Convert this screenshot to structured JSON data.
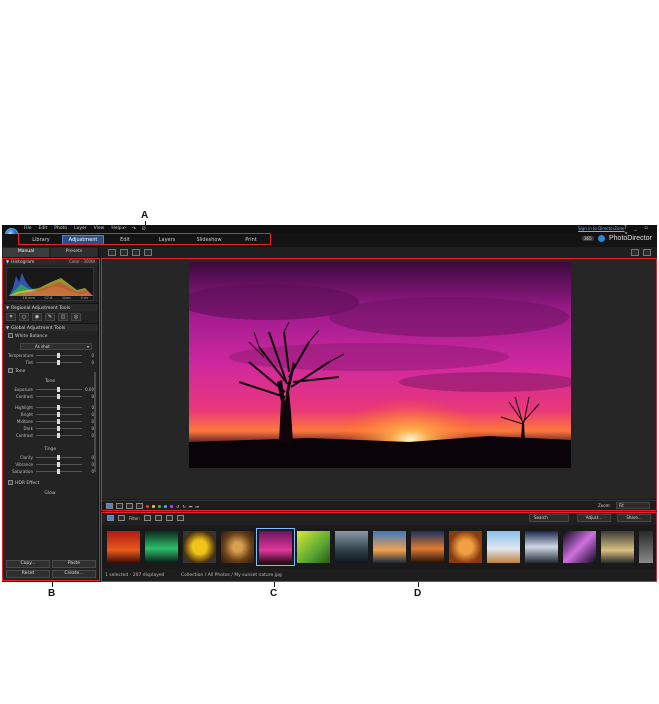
{
  "callouts": {
    "a": "A",
    "b": "B",
    "c": "C",
    "d": "D"
  },
  "menu": [
    "File",
    "Edit",
    "Photo",
    "Layer",
    "View",
    "Help"
  ],
  "undo_redo": "↶ ↷ ⊙",
  "signin": "Sign in to DirectorZone",
  "window_controls": "? _ ▫ ×",
  "modes": [
    "Library",
    "Adjustment",
    "Edit",
    "Layers",
    "Slideshow",
    "Print"
  ],
  "active_mode": "Adjustment",
  "brand": {
    "badge": "365",
    "name": "PhotoDirector"
  },
  "left": {
    "tabs": [
      "Manual",
      "Presets"
    ],
    "histogram": {
      "title": "Histogram",
      "mode": "Color · 300W",
      "info": [
        "-",
        "16 mm",
        "f/2.8",
        "1/sec",
        "0 ev"
      ]
    },
    "regional": "Regional Adjustment Tools",
    "global": "Global Adjustment Tools",
    "white_balance": {
      "title": "White Balance",
      "preset": "As shot",
      "sliders": [
        {
          "label": "Temperature",
          "value": "0"
        },
        {
          "label": "Tint",
          "value": "0"
        }
      ]
    },
    "tone": {
      "title": "Tone",
      "group": "Tone",
      "sliders": [
        {
          "label": "Exposure",
          "value": "0.00"
        },
        {
          "label": "Contrast",
          "value": "0"
        },
        {
          "label": "Highlight",
          "value": "0"
        },
        {
          "label": "Bright",
          "value": "0"
        },
        {
          "label": "Midtone",
          "value": "0"
        },
        {
          "label": "Dark",
          "value": "0"
        },
        {
          "label": "Contrast",
          "value": "0"
        }
      ]
    },
    "tinge": {
      "group": "Tinge",
      "sliders": [
        {
          "label": "Clarity",
          "value": "0"
        },
        {
          "label": "Vibrance",
          "value": "0"
        },
        {
          "label": "Saturation",
          "value": "0"
        }
      ]
    },
    "hdr": {
      "title": "HDR Effect",
      "group": "Glow"
    },
    "buttons": {
      "copy": "Copy...",
      "paste": "Paste",
      "reset": "Reset",
      "create": "Create..."
    }
  },
  "viewbar": {
    "zoom_label": "Zoom:",
    "zoom_value": "Fit"
  },
  "browser": {
    "filter": "Filter:",
    "search": "Search",
    "adjust": "Adjust...",
    "share": "Share..."
  },
  "status": {
    "selected": "1 selected - 207 displayed",
    "path": "Collection / All Photos / My sunset nature.jpg"
  },
  "colors": {
    "accent": "#4f7fc9",
    "callout_box": "#e8212a"
  }
}
